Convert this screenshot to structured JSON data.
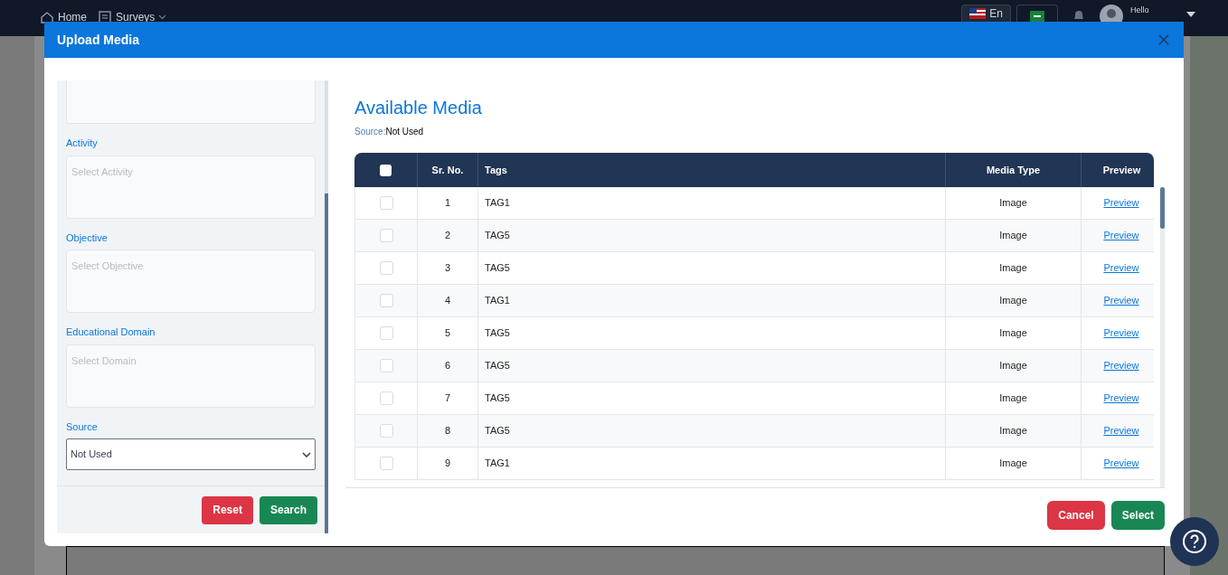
{
  "navbar": {
    "items": [
      {
        "label": "Home",
        "kind": "home"
      },
      {
        "label": "Surveys",
        "kind": "survey"
      }
    ],
    "language": "En",
    "greeting": "Hello"
  },
  "modal": {
    "title": "Upload Media",
    "filters": [
      {
        "label": "Activity",
        "placeholder": "Select Activity"
      },
      {
        "label": "Objective",
        "placeholder": "Select Objective"
      },
      {
        "label": "Educational Domain",
        "placeholder": "Select Domain"
      }
    ],
    "source": {
      "label": "Source",
      "value": "Not Used"
    },
    "filter_buttons": [
      {
        "label": "Reset",
        "kind": "danger"
      },
      {
        "label": "Search",
        "kind": "success"
      }
    ],
    "heading": "Available Media",
    "source_label": "Source:",
    "source_value": "Not Used",
    "table": {
      "columns": [
        "Sr. No.",
        "Tags",
        "Media Type",
        "Preview"
      ],
      "select_all_checked": false,
      "rows": [
        {
          "sr": "1",
          "tag": "TAG1",
          "type": "Image",
          "preview": "Preview",
          "checked": false
        },
        {
          "sr": "2",
          "tag": "TAG5",
          "type": "Image",
          "preview": "Preview",
          "checked": false
        },
        {
          "sr": "3",
          "tag": "TAG5",
          "type": "Image",
          "preview": "Preview",
          "checked": false
        },
        {
          "sr": "4",
          "tag": "TAG1",
          "type": "Image",
          "preview": "Preview",
          "checked": false
        },
        {
          "sr": "5",
          "tag": "TAG5",
          "type": "Image",
          "preview": "Preview",
          "checked": false
        },
        {
          "sr": "6",
          "tag": "TAG5",
          "type": "Image",
          "preview": "Preview",
          "checked": false
        },
        {
          "sr": "7",
          "tag": "TAG5",
          "type": "Image",
          "preview": "Preview",
          "checked": false
        },
        {
          "sr": "8",
          "tag": "TAG5",
          "type": "Image",
          "preview": "Preview",
          "checked": false
        },
        {
          "sr": "9",
          "tag": "TAG1",
          "type": "Image",
          "preview": "Preview",
          "checked": false
        }
      ]
    },
    "footer_buttons": [
      {
        "label": "Cancel",
        "kind": "danger"
      },
      {
        "label": "Select",
        "kind": "success"
      }
    ]
  }
}
